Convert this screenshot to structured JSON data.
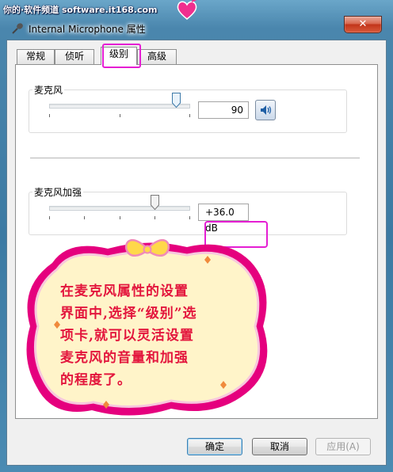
{
  "watermark": {
    "text": "你的·软件频道 software.it168.com"
  },
  "window": {
    "title": "Internal Microphone 属性",
    "close_glyph": "✕"
  },
  "tabs": [
    {
      "label": "常规"
    },
    {
      "label": "侦听"
    },
    {
      "label": "级别",
      "selected": true
    },
    {
      "label": "高级"
    }
  ],
  "levels": {
    "microphone": {
      "label": "麦克风",
      "value": "90",
      "level_percent": 90
    },
    "boost": {
      "label": "麦克风加强",
      "value": "+36.0 dB",
      "level_percent": 75
    }
  },
  "callout": {
    "lines": [
      "在麦克风属性的设置",
      "界面中,选择“级别”选",
      "项卡,就可以灵活设置",
      "麦克风的音量和加强",
      "的程度了。"
    ]
  },
  "buttons": {
    "ok": "确定",
    "cancel": "取消",
    "apply": "应用(A)"
  },
  "icons": {
    "app": "microphone-icon",
    "speaker": "speaker-icon",
    "logo": "heart-logo"
  },
  "colors": {
    "highlight": "#e51ed3",
    "callout_text": "#e3163d",
    "callout_border": "#e5007e"
  }
}
